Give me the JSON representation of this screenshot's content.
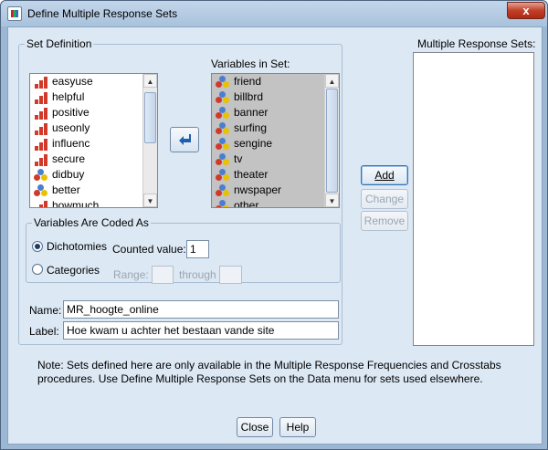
{
  "window": {
    "title": "Define Multiple Response Sets",
    "close_glyph": "x"
  },
  "set_definition": {
    "group_label": "Set Definition",
    "source_variables": [
      {
        "name": "easyuse",
        "icon": "scale-icon"
      },
      {
        "name": "helpful",
        "icon": "scale-icon"
      },
      {
        "name": "positive",
        "icon": "scale-icon"
      },
      {
        "name": "useonly",
        "icon": "scale-icon"
      },
      {
        "name": "influenc",
        "icon": "scale-icon"
      },
      {
        "name": "secure",
        "icon": "scale-icon"
      },
      {
        "name": "didbuy",
        "icon": "nominal-icon"
      },
      {
        "name": "better",
        "icon": "nominal-icon"
      },
      {
        "name": "howmuch",
        "icon": "scale-icon"
      }
    ],
    "variables_in_set_label": "Variables in Set:",
    "variables_in_set": [
      {
        "name": "friend",
        "icon": "nominal-icon"
      },
      {
        "name": "billbrd",
        "icon": "nominal-icon"
      },
      {
        "name": "banner",
        "icon": "nominal-icon"
      },
      {
        "name": "surfing",
        "icon": "nominal-icon"
      },
      {
        "name": "sengine",
        "icon": "nominal-icon"
      },
      {
        "name": "tv",
        "icon": "nominal-icon"
      },
      {
        "name": "theater",
        "icon": "nominal-icon"
      },
      {
        "name": "nwspaper",
        "icon": "nominal-icon"
      },
      {
        "name": "other",
        "icon": "nominal-icon"
      }
    ],
    "coded_as": {
      "group_label": "Variables Are Coded As",
      "dichotomies_label": "Dichotomies",
      "categories_label": "Categories",
      "selected": "Dichotomies",
      "counted_value_label": "Counted value:",
      "counted_value": "1",
      "range_label": "Range:",
      "through_label": "through",
      "range_from": "",
      "range_to": ""
    },
    "name_label": "Name:",
    "name_value": "MR_hoogte_online",
    "label_label": "Label:",
    "label_value": "Hoe kwam u achter het bestaan vande site"
  },
  "multiple_response_sets": {
    "label": "Multiple Response Sets:",
    "items": []
  },
  "buttons": {
    "add": "Add",
    "change": "Change",
    "remove": "Remove",
    "close": "Close",
    "help": "Help"
  },
  "note": "Note: Sets defined here are only available in the Multiple Response Frequencies and Crosstabs procedures. Use Define Multiple Response Sets on the Data menu for sets used elsewhere.",
  "colors": {
    "frame": "#9cb7d3",
    "client": "#dce8f4",
    "selected_list": "#c3c3c3",
    "close_button": "#c0402a"
  }
}
